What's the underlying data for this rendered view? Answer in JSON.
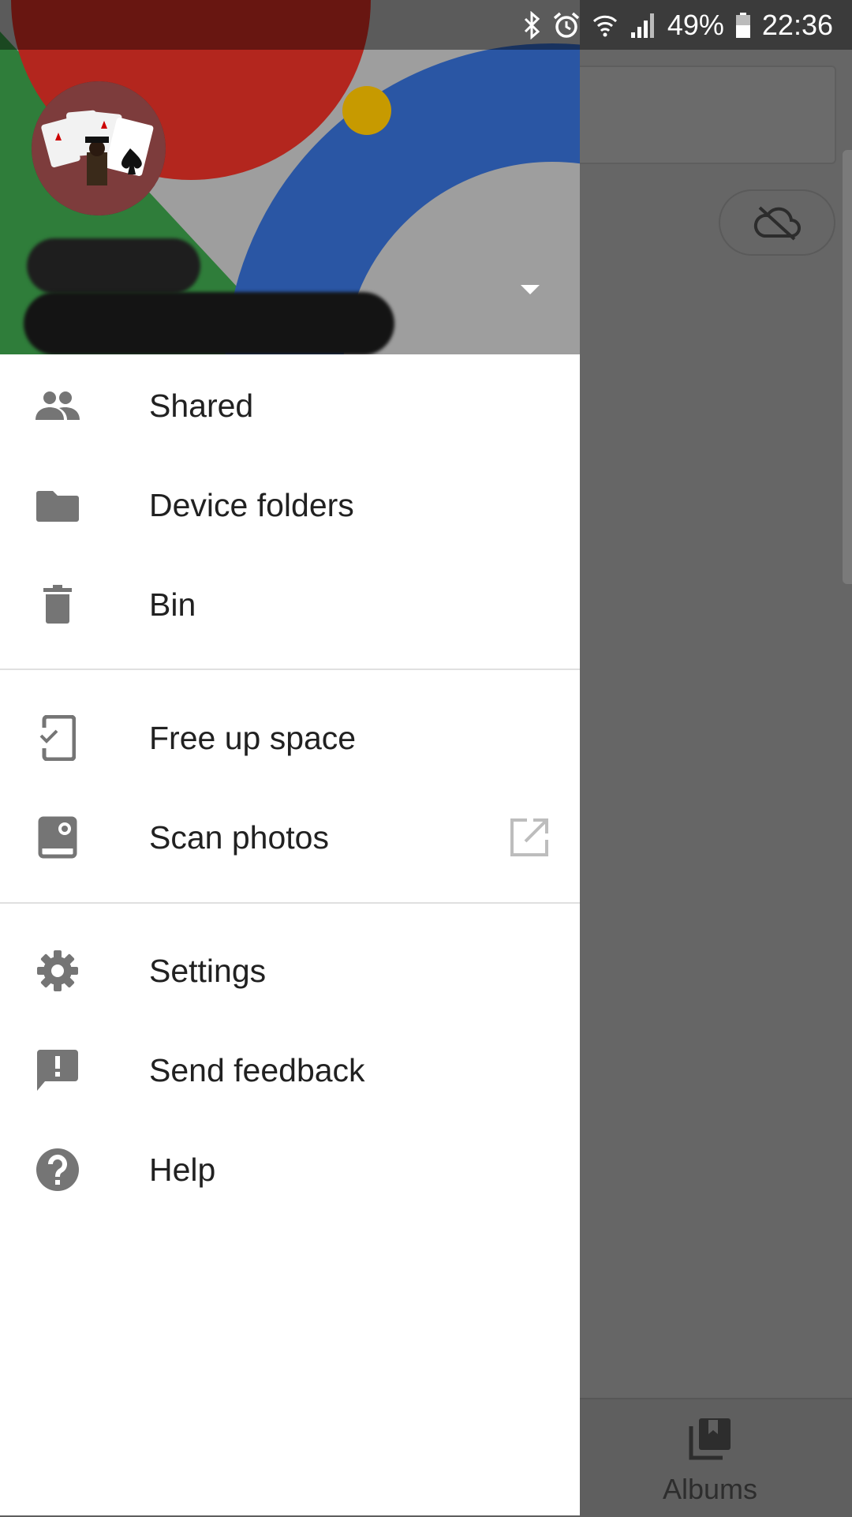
{
  "status_bar": {
    "battery": "49%",
    "time": "22:36"
  },
  "drawer": {
    "section1": [
      {
        "label": "Shared",
        "icon": "people-icon"
      },
      {
        "label": "Device folders",
        "icon": "folder-icon"
      },
      {
        "label": "Bin",
        "icon": "trash-icon"
      }
    ],
    "section2": [
      {
        "label": "Free up space",
        "icon": "phone-check-icon"
      },
      {
        "label": "Scan photos",
        "icon": "photoscan-icon",
        "trailing_icon": "open-external-icon"
      }
    ],
    "section3": [
      {
        "label": "Settings",
        "icon": "gear-icon"
      },
      {
        "label": "Send feedback",
        "icon": "feedback-icon"
      },
      {
        "label": "Help",
        "icon": "help-icon"
      }
    ]
  },
  "background": {
    "bottom_nav": {
      "albums_label": "Albums"
    }
  },
  "colors": {
    "icon_gray": "#757575",
    "text_dark": "#212121",
    "scrim": "#666666",
    "header_red": "#b3261e",
    "header_blue": "#2a56a4",
    "header_green": "#2f7d3a",
    "header_yellow": "#c79a00"
  }
}
